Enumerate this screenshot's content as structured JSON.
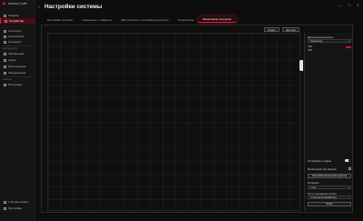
{
  "app": {
    "brand": "Armoury Crate",
    "window_controls": [
      "—",
      "☐",
      "✕"
    ]
  },
  "sidebar": {
    "items": [
      {
        "label": "Главная",
        "icon": "home-icon"
      },
      {
        "label": "Устройство",
        "icon": "device-icon",
        "active": true
      },
      {
        "label": "Aura Sync",
        "icon": "aura-icon"
      },
      {
        "label": "GameVisual",
        "icon": "gamevisual-icon"
      },
      {
        "label": "Сценарии",
        "icon": "scenario-icon"
      },
      {
        "label": "Обновление",
        "icon": "update-icon"
      },
      {
        "label": "Аудио",
        "icon": "audio-icon"
      },
      {
        "label": "Мультимедиа",
        "icon": "media-icon"
      },
      {
        "label": "Уведомления",
        "icon": "bell-icon"
      },
      {
        "label": "Настройки",
        "icon": "settings-icon"
      }
    ],
    "sections": [
      "Инструменты",
      "Новости"
    ],
    "footer": [
      "Учётная запись",
      "Настройки"
    ]
  },
  "header": {
    "title": "Настройки системы"
  },
  "tabs": [
    {
      "label": "Настройки системы"
    },
    {
      "label": "Освещение и эффекты"
    },
    {
      "label": "Вентиляторы и производительность"
    },
    {
      "label": "Подсистема"
    },
    {
      "label": "Мониторинг ресурсов",
      "active": true
    }
  ],
  "actions": {
    "buttons": [
      "Сброс",
      "Экспорт"
    ]
  },
  "right_panel": {
    "sensor_section_label": "Датчики мониторинга",
    "sensor_select_value": "Процессор",
    "sensors": [
      {
        "name": "CPU",
        "color": "#c8102e"
      },
      {
        "name": "GPU",
        "color": "#c8102e"
      }
    ],
    "realtime_label": "Отображать график",
    "realtime_on": true,
    "autorecord_label": "Мониторинг при запуске",
    "autorecord_checked": false,
    "record_button": "Настройки мониторинга данных",
    "interval_label": "Интервал",
    "interval_value": "1 сек",
    "save_path_label": "Путь сохранения записи",
    "save_path_value": "C:\\ArmouryCrate\\Monitor",
    "browse_button": "Обзор"
  },
  "colors": {
    "accent": "#e01a35",
    "accent_dark": "#4a0d16",
    "background": "#0d0d0d"
  }
}
